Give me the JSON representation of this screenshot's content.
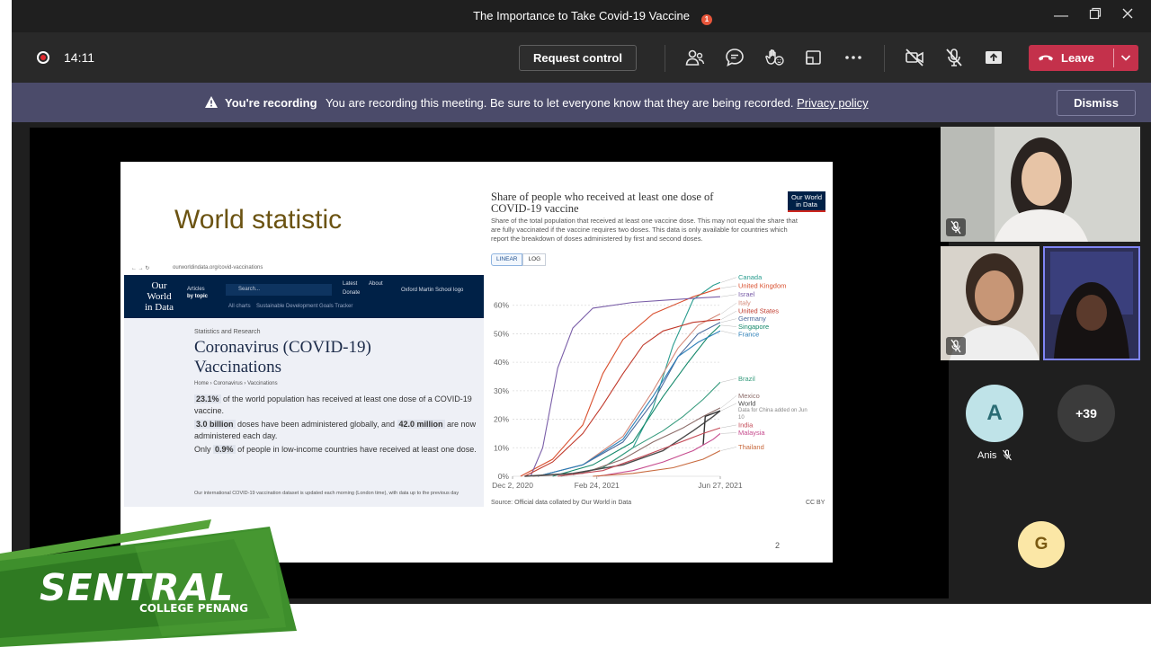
{
  "window": {
    "title": "The Importance to Take Covid-19 Vaccine"
  },
  "toolbar": {
    "timer": "14:11",
    "request_control_label": "Request control",
    "participants_badge": "1",
    "leave_label": "Leave"
  },
  "banner": {
    "title": "You're recording",
    "message": "You are recording this meeting. Be sure to let everyone know that they are being recorded.",
    "link": "Privacy policy",
    "dismiss_label": "Dismiss"
  },
  "slide": {
    "title": "World statistic",
    "page_number": "2",
    "webpage": {
      "url": "ourworldindata.org/covid-vaccinations",
      "logo": [
        "Our",
        "World",
        "in Data"
      ],
      "nav_articles": "Articles",
      "nav_by_topic": "by topic",
      "search_placeholder": "Search...",
      "nav_latest": "Latest",
      "nav_about": "About",
      "nav_donate": "Donate",
      "nav_all_charts": "All charts",
      "nav_sdg": "Sustainable Development Goals Tracker",
      "oxford_logo": "Oxford Martin School logo",
      "kicker": "Statistics and Research",
      "heading": "Coronavirus (COVID-19) Vaccinations",
      "crumbs": [
        "Home",
        "Coronavirus",
        "Vaccinations"
      ],
      "stat1_value": "23.1%",
      "stat1_text": "of the world population has received at least one dose of a COVID-19 vaccine.",
      "stat2_value": "3.0 billion",
      "stat2_mid": "doses have been administered globally, and",
      "stat2_value2": "42.0 million",
      "stat2_text": "are now administered each day.",
      "stat3_pre": "Only",
      "stat3_value": "0.9%",
      "stat3_text": "of people in low-income countries have received at least one dose.",
      "footer": "Our international COVID-19 vaccination dataset is updated each morning (London time), with data up to the previous day"
    },
    "chart": {
      "title": "Share of people who received at least one dose of COVID-19 vaccine",
      "subtitle": "Share of the total population that received at least one vaccine dose. This may not equal the share that are fully vaccinated if the vaccine requires two doses. This data is only available for countries which report the breakdown of doses administered by first and second doses.",
      "badge": [
        "Our World",
        "in Data"
      ],
      "toggle_linear": "LINEAR",
      "toggle_log": "LOG",
      "source": "Source: Official data collated by Our World in Data",
      "license": "CC BY",
      "china_note": [
        "Data for China added on Jun",
        "10"
      ]
    }
  },
  "chart_data": {
    "type": "line",
    "x_unit": "days since Dec 2, 2020",
    "x_tick_labels": [
      "Dec 2, 2020",
      "Feb 24, 2021",
      "Jun 27, 2021"
    ],
    "x_ticks": [
      0,
      84,
      207
    ],
    "x_range": [
      0,
      207
    ],
    "y_ticks": [
      "0%",
      "10%",
      "20%",
      "30%",
      "40%",
      "50%",
      "60%"
    ],
    "ylim": [
      0,
      70
    ],
    "grid": "horizontal dotted",
    "series": [
      {
        "name": "Canada",
        "color": "#2a9d8f",
        "points": [
          [
            60,
            0.5
          ],
          [
            90,
            3
          ],
          [
            120,
            10
          ],
          [
            140,
            24
          ],
          [
            160,
            46
          ],
          [
            180,
            62
          ],
          [
            200,
            67
          ],
          [
            207,
            68
          ]
        ]
      },
      {
        "name": "United Kingdom",
        "color": "#d9502f",
        "points": [
          [
            8,
            0
          ],
          [
            40,
            6
          ],
          [
            70,
            18
          ],
          [
            90,
            36
          ],
          [
            110,
            48
          ],
          [
            140,
            57
          ],
          [
            180,
            63
          ],
          [
            207,
            66
          ]
        ]
      },
      {
        "name": "Israel",
        "color": "#7a5ea8",
        "points": [
          [
            18,
            0
          ],
          [
            30,
            10
          ],
          [
            45,
            38
          ],
          [
            60,
            52
          ],
          [
            80,
            59
          ],
          [
            120,
            61
          ],
          [
            160,
            62
          ],
          [
            207,
            63
          ]
        ]
      },
      {
        "name": "Italy",
        "color": "#d48a7a",
        "points": [
          [
            25,
            0
          ],
          [
            70,
            4
          ],
          [
            110,
            14
          ],
          [
            140,
            30
          ],
          [
            165,
            45
          ],
          [
            185,
            53
          ],
          [
            207,
            57
          ]
        ]
      },
      {
        "name": "United States",
        "color": "#c0392b",
        "points": [
          [
            12,
            0
          ],
          [
            40,
            5
          ],
          [
            70,
            15
          ],
          [
            90,
            25
          ],
          [
            110,
            36
          ],
          [
            130,
            46
          ],
          [
            150,
            51
          ],
          [
            180,
            54
          ],
          [
            207,
            55
          ]
        ]
      },
      {
        "name": "Germany",
        "color": "#4c6a9c",
        "points": [
          [
            25,
            0
          ],
          [
            70,
            4
          ],
          [
            110,
            12
          ],
          [
            140,
            26
          ],
          [
            165,
            42
          ],
          [
            185,
            50
          ],
          [
            207,
            54
          ]
        ]
      },
      {
        "name": "Singapore",
        "color": "#15896b",
        "points": [
          [
            40,
            0
          ],
          [
            80,
            4
          ],
          [
            120,
            12
          ],
          [
            150,
            28
          ],
          [
            175,
            40
          ],
          [
            195,
            49
          ],
          [
            207,
            53
          ]
        ]
      },
      {
        "name": "France",
        "color": "#2c7fb8",
        "points": [
          [
            25,
            0
          ],
          [
            70,
            4
          ],
          [
            110,
            13
          ],
          [
            140,
            28
          ],
          [
            165,
            42
          ],
          [
            185,
            47
          ],
          [
            207,
            51
          ]
        ]
      },
      {
        "name": "Brazil",
        "color": "#389c7e",
        "points": [
          [
            48,
            0
          ],
          [
            90,
            3
          ],
          [
            120,
            10
          ],
          [
            150,
            16
          ],
          [
            170,
            21
          ],
          [
            190,
            27
          ],
          [
            207,
            33
          ]
        ]
      },
      {
        "name": "Mexico",
        "color": "#8e6e6b",
        "points": [
          [
            20,
            0
          ],
          [
            70,
            1
          ],
          [
            110,
            6
          ],
          [
            140,
            12
          ],
          [
            170,
            17
          ],
          [
            190,
            21
          ],
          [
            207,
            24
          ]
        ]
      },
      {
        "name": "World",
        "color": "#4b4b4b",
        "points": [
          [
            12,
            0
          ],
          [
            60,
            1
          ],
          [
            110,
            4
          ],
          [
            150,
            9
          ],
          [
            180,
            16
          ],
          [
            200,
            21
          ],
          [
            207,
            23
          ]
        ]
      },
      {
        "name": "China",
        "color": "#333333",
        "points": [
          [
            190,
            11
          ],
          [
            192,
            21
          ],
          [
            207,
            23
          ]
        ]
      },
      {
        "name": "India",
        "color": "#c44b58",
        "points": [
          [
            45,
            0
          ],
          [
            90,
            2
          ],
          [
            130,
            7
          ],
          [
            160,
            11
          ],
          [
            190,
            15
          ],
          [
            207,
            17
          ]
        ]
      },
      {
        "name": "Malaysia",
        "color": "#c64b8e",
        "points": [
          [
            85,
            0
          ],
          [
            120,
            2
          ],
          [
            150,
            5
          ],
          [
            180,
            9
          ],
          [
            200,
            13
          ],
          [
            207,
            15
          ]
        ]
      },
      {
        "name": "Thailand",
        "color": "#c86a3e",
        "points": [
          [
            80,
            0
          ],
          [
            120,
            1
          ],
          [
            160,
            3
          ],
          [
            190,
            6
          ],
          [
            207,
            9
          ]
        ]
      }
    ]
  },
  "participants": {
    "anis_name": "Anis",
    "anis_initial": "A",
    "more_count": "+39",
    "g_initial": "G"
  },
  "logo": {
    "main": "SENTRAL",
    "sub": "COLLEGE PENANG"
  },
  "colors": {
    "leave": "#c4314b",
    "banner": "#4b4b6a",
    "toolbar": "#292929",
    "logo_green": "#3e8f2c"
  }
}
